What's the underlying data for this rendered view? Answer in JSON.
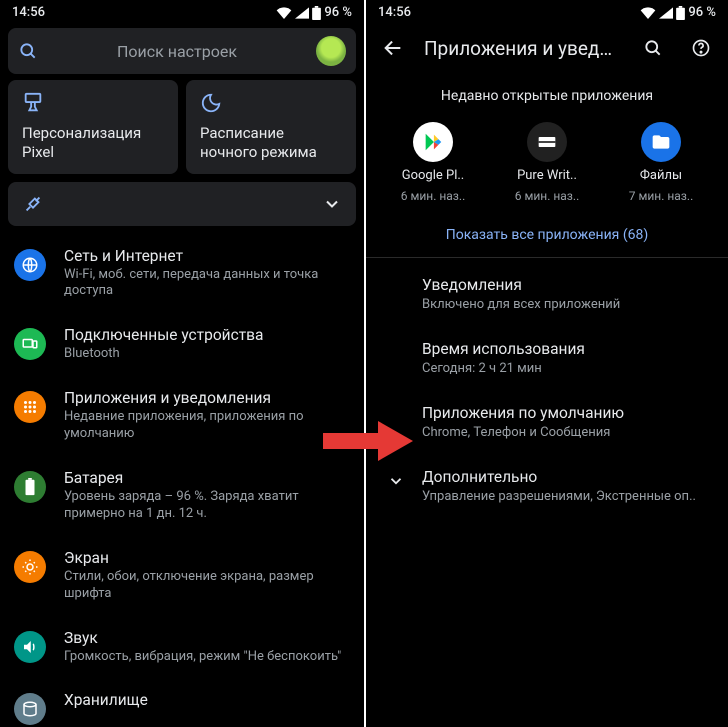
{
  "status": {
    "time": "14:56",
    "battery": "96 %"
  },
  "left": {
    "search_placeholder": "Поиск настроек",
    "quick": {
      "personalization": "Персонализация Pixel",
      "night_schedule": "Расписание ночного режима"
    },
    "items": [
      {
        "icon": "globe",
        "color": "#1a73e8",
        "title": "Сеть и Интернет",
        "sub": "Wi-Fi, моб. сети, передача данных и точка доступа"
      },
      {
        "icon": "devices",
        "color": "#1db954",
        "title": "Подключенные устройства",
        "sub": "Bluetooth"
      },
      {
        "icon": "apps",
        "color": "#f57c00",
        "title": "Приложения и уведомления",
        "sub": "Недавние приложения, приложения по умолчанию"
      },
      {
        "icon": "battery",
        "color": "#2e7d32",
        "title": "Батарея",
        "sub": "Уровень заряда – 96 %. Заряда хватит примерно на 1 дн. 12 ч."
      },
      {
        "icon": "display",
        "color": "#f57c00",
        "title": "Экран",
        "sub": "Стили, обои, отключение экрана, размер шрифта"
      },
      {
        "icon": "sound",
        "color": "#009688",
        "title": "Звук",
        "sub": "Громкость, вибрация, режим \"Не беспокоить\""
      },
      {
        "icon": "storage",
        "color": "#607d8b",
        "title": "Хранилище",
        "sub": ""
      }
    ]
  },
  "right": {
    "title": "Приложения и уведо...",
    "recent_header": "Недавно открытые приложения",
    "apps": [
      {
        "name": "Google Pl..",
        "sub": "6 мин. наз..",
        "icon": "play"
      },
      {
        "name": "Pure Writ..",
        "sub": "6 мин. наз..",
        "icon": "pure"
      },
      {
        "name": "Файлы",
        "sub": "7 мин. наз..",
        "icon": "files"
      }
    ],
    "show_all": "Показать все приложения (68)",
    "rows": [
      {
        "title": "Уведомления",
        "sub": "Включено для всех приложений"
      },
      {
        "title": "Время использования",
        "sub": "Сегодня: 2 ч 21 мин"
      },
      {
        "title": "Приложения по умолчанию",
        "sub": "Chrome, Телефон и Сообщения"
      }
    ],
    "advanced": {
      "title": "Дополнительно",
      "sub": "Управление разрешениями, Экстренные оп.."
    }
  }
}
